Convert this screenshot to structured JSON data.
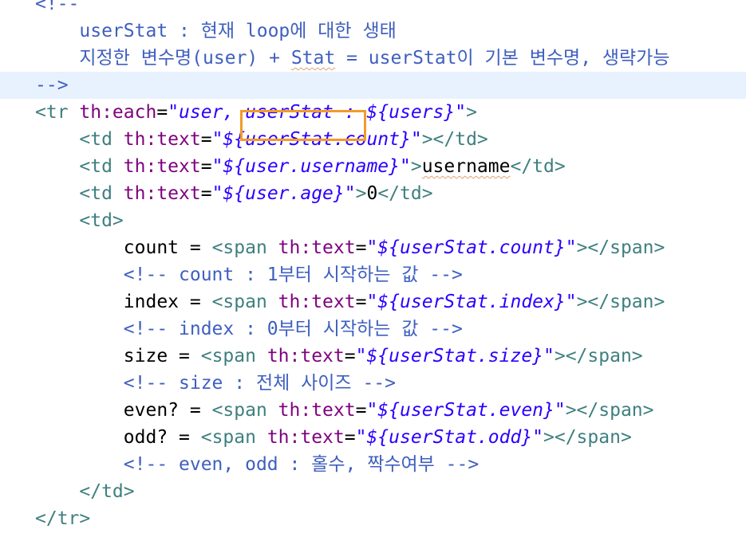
{
  "editor": {
    "lines": [
      {
        "tokens": [
          {
            "cls": "cm",
            "text": "<!--"
          }
        ]
      },
      {
        "tokens": [
          {
            "cls": "cm",
            "text": "    userStat : 현재 loop에 대한 생태"
          }
        ]
      },
      {
        "tokens": [
          {
            "cls": "cm",
            "text": "    지정한 변수명(user) + "
          },
          {
            "cls": "cm squiggle",
            "text": "Stat"
          },
          {
            "cls": "cm",
            "text": " = userStat이 기본 변수명, 생략가능"
          }
        ]
      },
      {
        "tokens": [
          {
            "cls": "cm",
            "text": "-->"
          }
        ]
      },
      {
        "tokens": [
          {
            "cls": "tg",
            "text": "<tr "
          },
          {
            "cls": "at",
            "text": "th:each"
          },
          {
            "cls": "tx",
            "text": "="
          },
          {
            "cls": "st",
            "text": "\"user, userStat : ${users}\""
          },
          {
            "cls": "tg",
            "text": ">"
          }
        ]
      },
      {
        "tokens": [
          {
            "cls": "tg",
            "text": "    <td "
          },
          {
            "cls": "at",
            "text": "th:text"
          },
          {
            "cls": "tx",
            "text": "="
          },
          {
            "cls": "st",
            "text": "\"${userStat.count}\""
          },
          {
            "cls": "tg",
            "text": "></td>"
          }
        ]
      },
      {
        "tokens": [
          {
            "cls": "tg",
            "text": "    <td "
          },
          {
            "cls": "at",
            "text": "th:text"
          },
          {
            "cls": "tx",
            "text": "="
          },
          {
            "cls": "st",
            "text": "\"${user.username}\""
          },
          {
            "cls": "tg",
            "text": ">"
          },
          {
            "cls": "tx squiggle",
            "text": "username"
          },
          {
            "cls": "tg",
            "text": "</td>"
          }
        ]
      },
      {
        "tokens": [
          {
            "cls": "tg",
            "text": "    <td "
          },
          {
            "cls": "at",
            "text": "th:text"
          },
          {
            "cls": "tx",
            "text": "="
          },
          {
            "cls": "st",
            "text": "\"${user.age}\""
          },
          {
            "cls": "tg",
            "text": ">"
          },
          {
            "cls": "tx",
            "text": "0"
          },
          {
            "cls": "tg",
            "text": "</td>"
          }
        ]
      },
      {
        "tokens": [
          {
            "cls": "tg",
            "text": "    <td>"
          }
        ]
      },
      {
        "tokens": [
          {
            "cls": "tx",
            "text": "        count = "
          },
          {
            "cls": "tg",
            "text": "<span "
          },
          {
            "cls": "at",
            "text": "th:text"
          },
          {
            "cls": "tx",
            "text": "="
          },
          {
            "cls": "st",
            "text": "\"${userStat.count}\""
          },
          {
            "cls": "tg",
            "text": "></span>"
          }
        ]
      },
      {
        "tokens": [
          {
            "cls": "cm",
            "text": "        <!-- count : 1부터 시작하는 값 -->"
          }
        ]
      },
      {
        "tokens": [
          {
            "cls": "tx",
            "text": "        index = "
          },
          {
            "cls": "tg",
            "text": "<span "
          },
          {
            "cls": "at",
            "text": "th:text"
          },
          {
            "cls": "tx",
            "text": "="
          },
          {
            "cls": "st",
            "text": "\"${userStat.index}\""
          },
          {
            "cls": "tg",
            "text": "></span>"
          }
        ]
      },
      {
        "tokens": [
          {
            "cls": "cm",
            "text": "        <!-- index : 0부터 시작하는 값 -->"
          }
        ]
      },
      {
        "tokens": [
          {
            "cls": "tx",
            "text": "        size = "
          },
          {
            "cls": "tg",
            "text": "<span "
          },
          {
            "cls": "at",
            "text": "th:text"
          },
          {
            "cls": "tx",
            "text": "="
          },
          {
            "cls": "st",
            "text": "\"${userStat.size}\""
          },
          {
            "cls": "tg",
            "text": "></span>"
          }
        ]
      },
      {
        "tokens": [
          {
            "cls": "cm",
            "text": "        <!-- size : 전체 사이즈 -->"
          }
        ]
      },
      {
        "tokens": [
          {
            "cls": "tx",
            "text": "        even? = "
          },
          {
            "cls": "tg",
            "text": "<span "
          },
          {
            "cls": "at",
            "text": "th:text"
          },
          {
            "cls": "tx",
            "text": "="
          },
          {
            "cls": "st",
            "text": "\"${userStat.even}\""
          },
          {
            "cls": "tg",
            "text": "></span>"
          }
        ]
      },
      {
        "tokens": [
          {
            "cls": "tx",
            "text": "        odd? = "
          },
          {
            "cls": "tg",
            "text": "<span "
          },
          {
            "cls": "at",
            "text": "th:text"
          },
          {
            "cls": "tx",
            "text": "="
          },
          {
            "cls": "st",
            "text": "\"${userStat.odd}\""
          },
          {
            "cls": "tg",
            "text": "></span>"
          }
        ]
      },
      {
        "tokens": [
          {
            "cls": "cm",
            "text": "        <!-- even, odd : 홀수, 짝수여부 -->"
          }
        ]
      },
      {
        "tokens": [
          {
            "cls": "tg",
            "text": "    </td>"
          }
        ]
      },
      {
        "tokens": [
          {
            "cls": "tg",
            "text": "</tr>"
          }
        ]
      }
    ],
    "current_line_index": 3,
    "highlight_color": "#f39a2b"
  }
}
